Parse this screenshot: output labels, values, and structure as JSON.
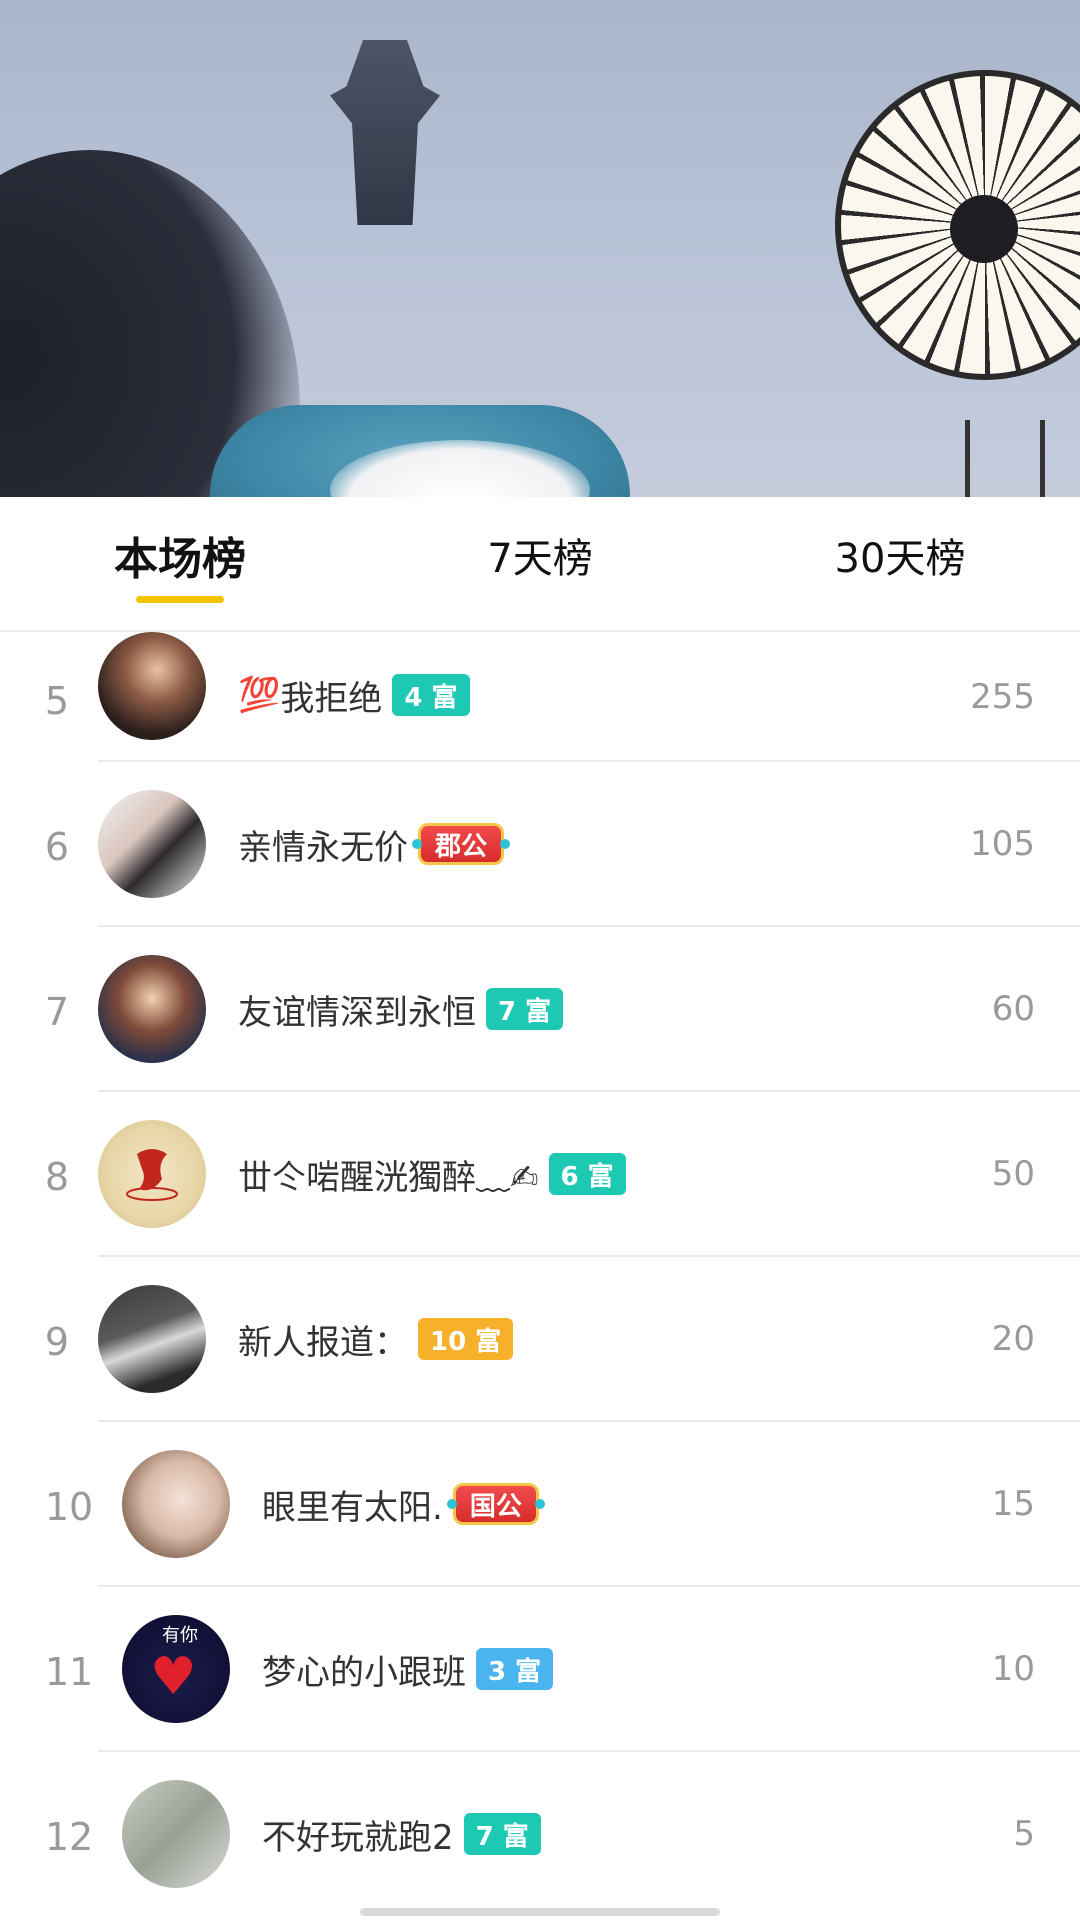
{
  "tabs": [
    {
      "label": "本场榜",
      "active": true
    },
    {
      "label": "7天榜",
      "active": false
    },
    {
      "label": "30天榜",
      "active": false
    }
  ],
  "accent_color": "#f4c400",
  "ranking": [
    {
      "rank": "5",
      "prefix_emoji": "💯",
      "name": "我拒绝",
      "badge": {
        "text": "4 富",
        "style": "teal"
      },
      "score": "255",
      "avatar_icon": "user-photo"
    },
    {
      "rank": "6",
      "prefix_emoji": "",
      "name": "亲情永无价",
      "badge": {
        "text": "郡公",
        "style": "noble"
      },
      "score": "105",
      "avatar_icon": "couple-photo"
    },
    {
      "rank": "7",
      "prefix_emoji": "",
      "name": "友谊情深到永恒",
      "badge": {
        "text": "7 富",
        "style": "teal"
      },
      "score": "60",
      "avatar_icon": "friends-photo"
    },
    {
      "rank": "8",
      "prefix_emoji": "",
      "name": "丗仒啱醒洸獨醉﹏✍",
      "badge": {
        "text": "6 富",
        "style": "teal"
      },
      "score": "50",
      "avatar_icon": "emblem-photo"
    },
    {
      "rank": "9",
      "prefix_emoji": "",
      "name": "新人报道：",
      "badge": {
        "text": "10 富",
        "style": "orange"
      },
      "score": "20",
      "avatar_icon": "room-photo"
    },
    {
      "rank": "10",
      "prefix_emoji": "",
      "name": "眼里有太阳.",
      "badge": {
        "text": "国公",
        "style": "noble"
      },
      "score": "15",
      "avatar_icon": "woman-photo"
    },
    {
      "rank": "11",
      "prefix_emoji": "",
      "name": "梦心的小跟班",
      "badge": {
        "text": "3 富",
        "style": "blue"
      },
      "score": "10",
      "avatar_icon": "heart-photo",
      "avatar_text": "有你"
    },
    {
      "rank": "12",
      "prefix_emoji": "",
      "name": "不好玩就跑2",
      "badge": {
        "text": "7 富",
        "style": "teal"
      },
      "score": "5",
      "avatar_icon": "blurry-photo"
    }
  ]
}
